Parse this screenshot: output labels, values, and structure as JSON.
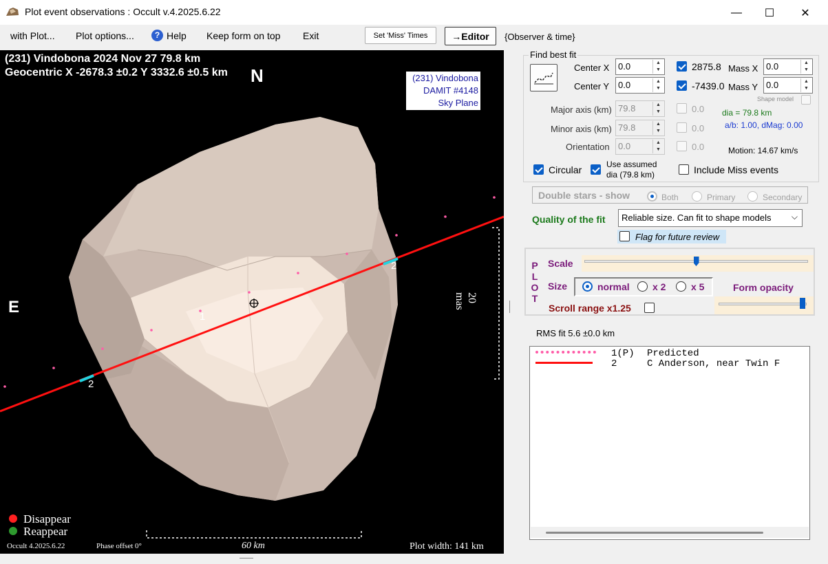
{
  "window": {
    "title": "Plot event observations : Occult v.4.2025.6.22",
    "minimize_glyph": "—",
    "maximize_glyph": "☐",
    "close_glyph": "✕"
  },
  "menu": {
    "with_plot": "with Plot...",
    "plot_options": "Plot options...",
    "help": "Help",
    "keep_on_top": "Keep form on top",
    "exit": "Exit",
    "set_miss_times": "Set 'Miss' Times",
    "editor": "→Editor",
    "observer_time": "{Observer & time}"
  },
  "plot": {
    "header_line1": "(231) Vindobona  2024 Nov 27   79.8 km",
    "header_line2": "Geocentric  X  -2678.3 ±0.2  Y 3332.6 ±0.5 km",
    "north": "N",
    "east": "E",
    "info_box": [
      "(231) Vindobona",
      "DAMIT #4148",
      "Sky Plane"
    ],
    "scale_right": "20 mas",
    "scale_bottom": "60 km",
    "legend_disappear": "Disappear",
    "legend_reappear": "Reappear",
    "footer_version": "Occult 4.2025.6.22",
    "footer_phase": "Phase offset 0°",
    "footer_width": "Plot width: 141 km",
    "chord1_label": "1",
    "chord2_label": "2",
    "colors": {
      "disappear": "#ff2020",
      "reappear": "#2e9a2e",
      "chord": "#ff1010",
      "marker": "#22d3e0",
      "predicted": "#ff5ca8"
    }
  },
  "fit": {
    "group_title": "Find best fit",
    "center_x_label": "Center X",
    "center_x": "0.0",
    "center_y_label": "Center Y",
    "center_y": "0.0",
    "x_offset": "2875.8",
    "y_offset": "-7439.0",
    "mass_x_label": "Mass X",
    "mass_x": "0.0",
    "mass_y_label": "Mass Y",
    "mass_y": "0.0",
    "shape_model_label": "Shape model",
    "major_axis_label": "Major axis (km)",
    "major_axis": "79.8",
    "major_axis_delta": "0.0",
    "minor_axis_label": "Minor axis (km)",
    "minor_axis": "79.8",
    "minor_axis_delta": "0.0",
    "orientation_label": "Orientation",
    "orientation": "0.0",
    "orientation_delta": "0.0",
    "dia_text": "dia = 79.8 km",
    "ab_text": "a/b: 1.00, dMag: 0.00",
    "motion_text": "Motion: 14.67 km/s",
    "circular_label": "Circular",
    "use_assumed_label_1": "Use assumed",
    "use_assumed_label_2": "dia (79.8 km)",
    "include_miss_label": "Include Miss events"
  },
  "double_stars": {
    "label": "Double stars - show",
    "both": "Both",
    "primary": "Primary",
    "secondary": "Secondary"
  },
  "quality": {
    "label": "Quality of the fit",
    "selected": "Reliable size. Can fit to shape models",
    "flag_label": "Flag for future review"
  },
  "plot_panel": {
    "vertical_label": [
      "P",
      "L",
      "O",
      "T"
    ],
    "scale_label": "Scale",
    "scale_value": 0.5,
    "size_label": "Size",
    "size_normal": "normal",
    "size_x2": "x 2",
    "size_x5": "x 5",
    "form_opacity_label": "Form opacity",
    "opacity_value": 0.95,
    "scroll_range_label": "Scroll range x1.25"
  },
  "rms": {
    "text": "RMS fit 5.6 ±0.0 km"
  },
  "chord_list": [
    {
      "num": "1(P)",
      "name": "Predicted",
      "style": "dotted"
    },
    {
      "num": "2",
      "name": "C Anderson, near Twin F",
      "style": "solid"
    }
  ]
}
